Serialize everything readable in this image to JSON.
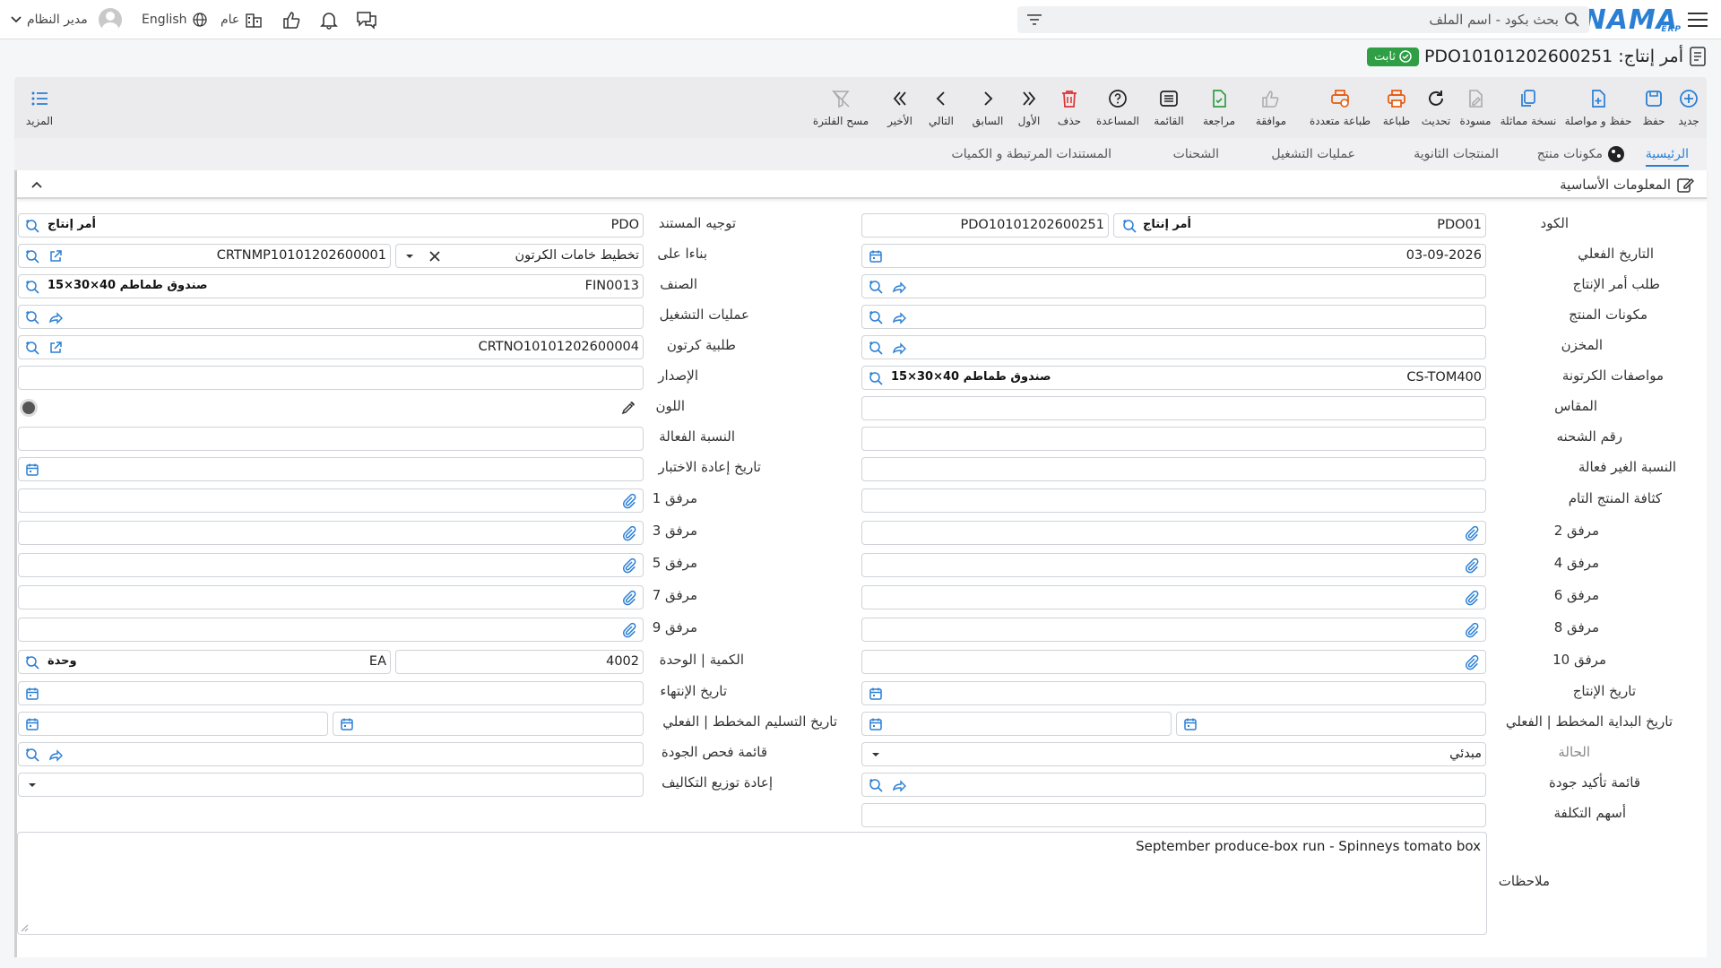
{
  "topbar": {
    "logo": "NAMA",
    "logo_sub": "ERP",
    "search_placeholder": "بحث بكود - اسم الملف",
    "user_name": "مدير النظام",
    "language": "English",
    "public_label": "عام"
  },
  "title": {
    "text": "أمر إنتاج: PDO10101202600251",
    "status": "ثابت"
  },
  "toolbar": {
    "new": "جديد",
    "save": "حفظ",
    "save_continue": "حفظ و مواصلة",
    "duplicate": "نسخة مماثلة",
    "draft": "مسودة",
    "refresh": "تحديث",
    "print": "طباعة",
    "multi_print": "طباعة متعددة",
    "approve": "موافقة",
    "review": "مراجعة",
    "list": "القائمة",
    "help": "المساعدة",
    "delete": "حذف",
    "first": "الأول",
    "previous": "السابق",
    "next": "التالي",
    "last": "الأخير",
    "clear_filter": "مسح الفلترة",
    "more": "المزيد"
  },
  "tabs": {
    "main": "الرئيسية",
    "components": "مكونات منتج",
    "byproducts": "المنتجات الثانوية",
    "operations": "عمليات التشغيل",
    "shipments": "الشحنات",
    "related": "المستندات المرتبطة و الكميات"
  },
  "section": {
    "title": "المعلومات الأساسية"
  },
  "labels": {
    "code": "الكود",
    "actual_date": "التاريخ الفعلي",
    "prod_order_request": "طلب أمر الإنتاج",
    "product_components": "مكونات المنتج",
    "warehouse": "المخزن",
    "carton_spec": "مواصفات الكرتونة",
    "size": "المقاس",
    "shipment_no": "رقم الشحنه",
    "ineffective_ratio": "النسبة الغير فعالة",
    "finished_density": "كثافة المنتج التام",
    "att2": "مرفق 2",
    "att4": "مرفق 4",
    "att6": "مرفق 6",
    "att8": "مرفق 8",
    "att10": "مرفق 10",
    "production_date": "تاريخ الإنتاج",
    "start_date": "تاريخ البداية المخطط | الفعلي",
    "status": "الحالة",
    "qa_list": "قائمة تأكيد جودة",
    "cost_shares": "أسهم التكلفة",
    "notes": "ملاحظات",
    "doc_direction": "توجيه المستند",
    "based_on": "بناءا على",
    "item": "الصنف",
    "operations": "عمليات التشغيل",
    "carton_request": "طلبية كرتون",
    "version": "الإصدار",
    "color": "اللون",
    "effective_ratio": "النسبة الفعالة",
    "retest_date": "تاريخ إعادة الاختبار",
    "att1": "مرفق 1",
    "att3": "مرفق 3",
    "att5": "مرفق 5",
    "att7": "مرفق 7",
    "att9": "مرفق 9",
    "qty_unit": "الكمية | الوحدة",
    "end_date": "تاريخ الإنتهاء",
    "delivery_date": "تاريخ التسليم المخطط | الفعلي",
    "qc_list": "قائمة فحص الجودة",
    "cost_redistribution": "إعادة توزيع التكاليف"
  },
  "values": {
    "code_prefix": "PDO01",
    "code_prefix_chip": "أمر إنتاج",
    "code_number": "PDO10101202600251",
    "actual_date": "03-09-2026",
    "carton_spec_code": "CS-TOM400",
    "carton_spec_name": "صندوق طماطم 40×30×15",
    "status": "مبدئي",
    "notes": "September produce-box run - Spinneys tomato box",
    "doc_direction_code": "PDO",
    "doc_direction_chip": "أمر إنتاج",
    "based_on_type": "تخطيط خامات الكرتون",
    "based_on_code": "CRTNMP10101202600001",
    "item_code": "FIN0013",
    "item_name": "صندوق طماطم 40×30×15",
    "carton_request_code": "CRTNO10101202600004",
    "quantity": "4002",
    "unit_code": "EA",
    "unit_chip": "وحدة"
  }
}
